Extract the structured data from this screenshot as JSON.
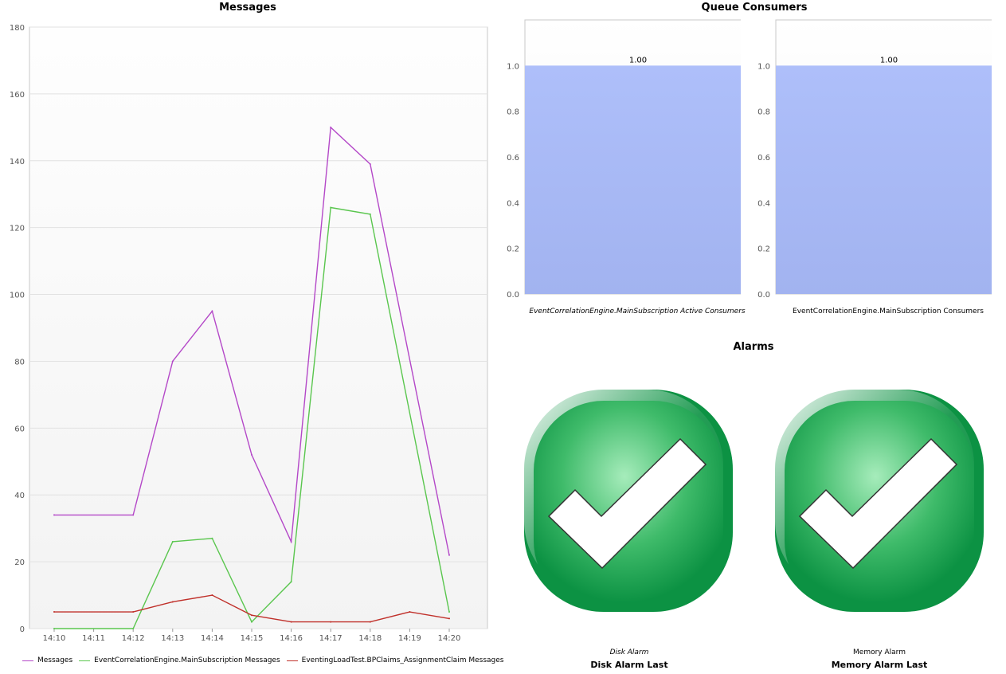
{
  "messages_panel": {
    "title": "Messages"
  },
  "queue_panel": {
    "title": "Queue Consumers"
  },
  "alarms_panel": {
    "title": "Alarms"
  },
  "chart_data": [
    {
      "type": "line",
      "title": "Messages",
      "x": [
        "14:10",
        "14:11",
        "14:12",
        "14:13",
        "14:14",
        "14:15",
        "14:16",
        "14:17",
        "14:18",
        "14:19",
        "14:20"
      ],
      "ylim": [
        0,
        180
      ],
      "yticks": [
        0,
        20,
        40,
        60,
        80,
        100,
        120,
        140,
        160,
        180
      ],
      "grid": true,
      "legend_position": "bottom",
      "series": [
        {
          "name": "Messages",
          "color": "#b448c8",
          "x": [
            "14:10",
            "14:12",
            "14:13",
            "14:14",
            "14:15",
            "14:16",
            "14:17",
            "14:18",
            "14:20"
          ],
          "values": [
            34,
            34,
            80,
            95,
            52,
            26,
            150,
            139,
            22
          ]
        },
        {
          "name": "EventCorrelationEngine.MainSubscription Messages",
          "color": "#5ac64e",
          "x": [
            "14:10",
            "14:12",
            "14:13",
            "14:14",
            "14:15",
            "14:16",
            "14:17",
            "14:18",
            "14:20"
          ],
          "values": [
            0,
            0,
            26,
            27,
            2,
            14,
            126,
            124,
            5
          ]
        },
        {
          "name": "EventingLoadTest.BPClaims_AssignmentClaim Messages",
          "color": "#c0302a",
          "x": [
            "14:10",
            "14:12",
            "14:13",
            "14:14",
            "14:15",
            "14:16",
            "14:17",
            "14:18",
            "14:19",
            "14:20"
          ],
          "values": [
            5,
            5,
            8,
            10,
            4,
            2,
            2,
            2,
            5,
            3
          ]
        }
      ]
    },
    {
      "type": "bar",
      "categories": [
        "EventCorrelationEngine.MainSubscription Active Consumers"
      ],
      "values": [
        1.0
      ],
      "value_labels": [
        "1.00"
      ],
      "ylim": [
        0,
        1.2
      ],
      "yticks": [
        "0.0",
        "0.2",
        "0.4",
        "0.6",
        "0.8",
        "1.0"
      ],
      "bar_color": "#aebffa"
    },
    {
      "type": "bar",
      "categories": [
        "EventCorrelationEngine.MainSubscription Consumers"
      ],
      "values": [
        1.0
      ],
      "value_labels": [
        "1.00"
      ],
      "ylim": [
        0,
        1.2
      ],
      "yticks": [
        "0.0",
        "0.2",
        "0.4",
        "0.6",
        "0.8",
        "1.0"
      ],
      "bar_color": "#aebffa"
    }
  ],
  "alarms": [
    {
      "caption": "Disk Alarm",
      "title": "Disk Alarm  Last",
      "status": "ok",
      "icon": "check-ok-icon"
    },
    {
      "caption": "Memory Alarm",
      "title": "Memory Alarm  Last",
      "status": "ok",
      "icon": "check-ok-icon"
    }
  ],
  "colors": {
    "bar": "#aebffa",
    "alarm_green": "#0f9a45",
    "alarm_light": "#a6ecbb"
  }
}
